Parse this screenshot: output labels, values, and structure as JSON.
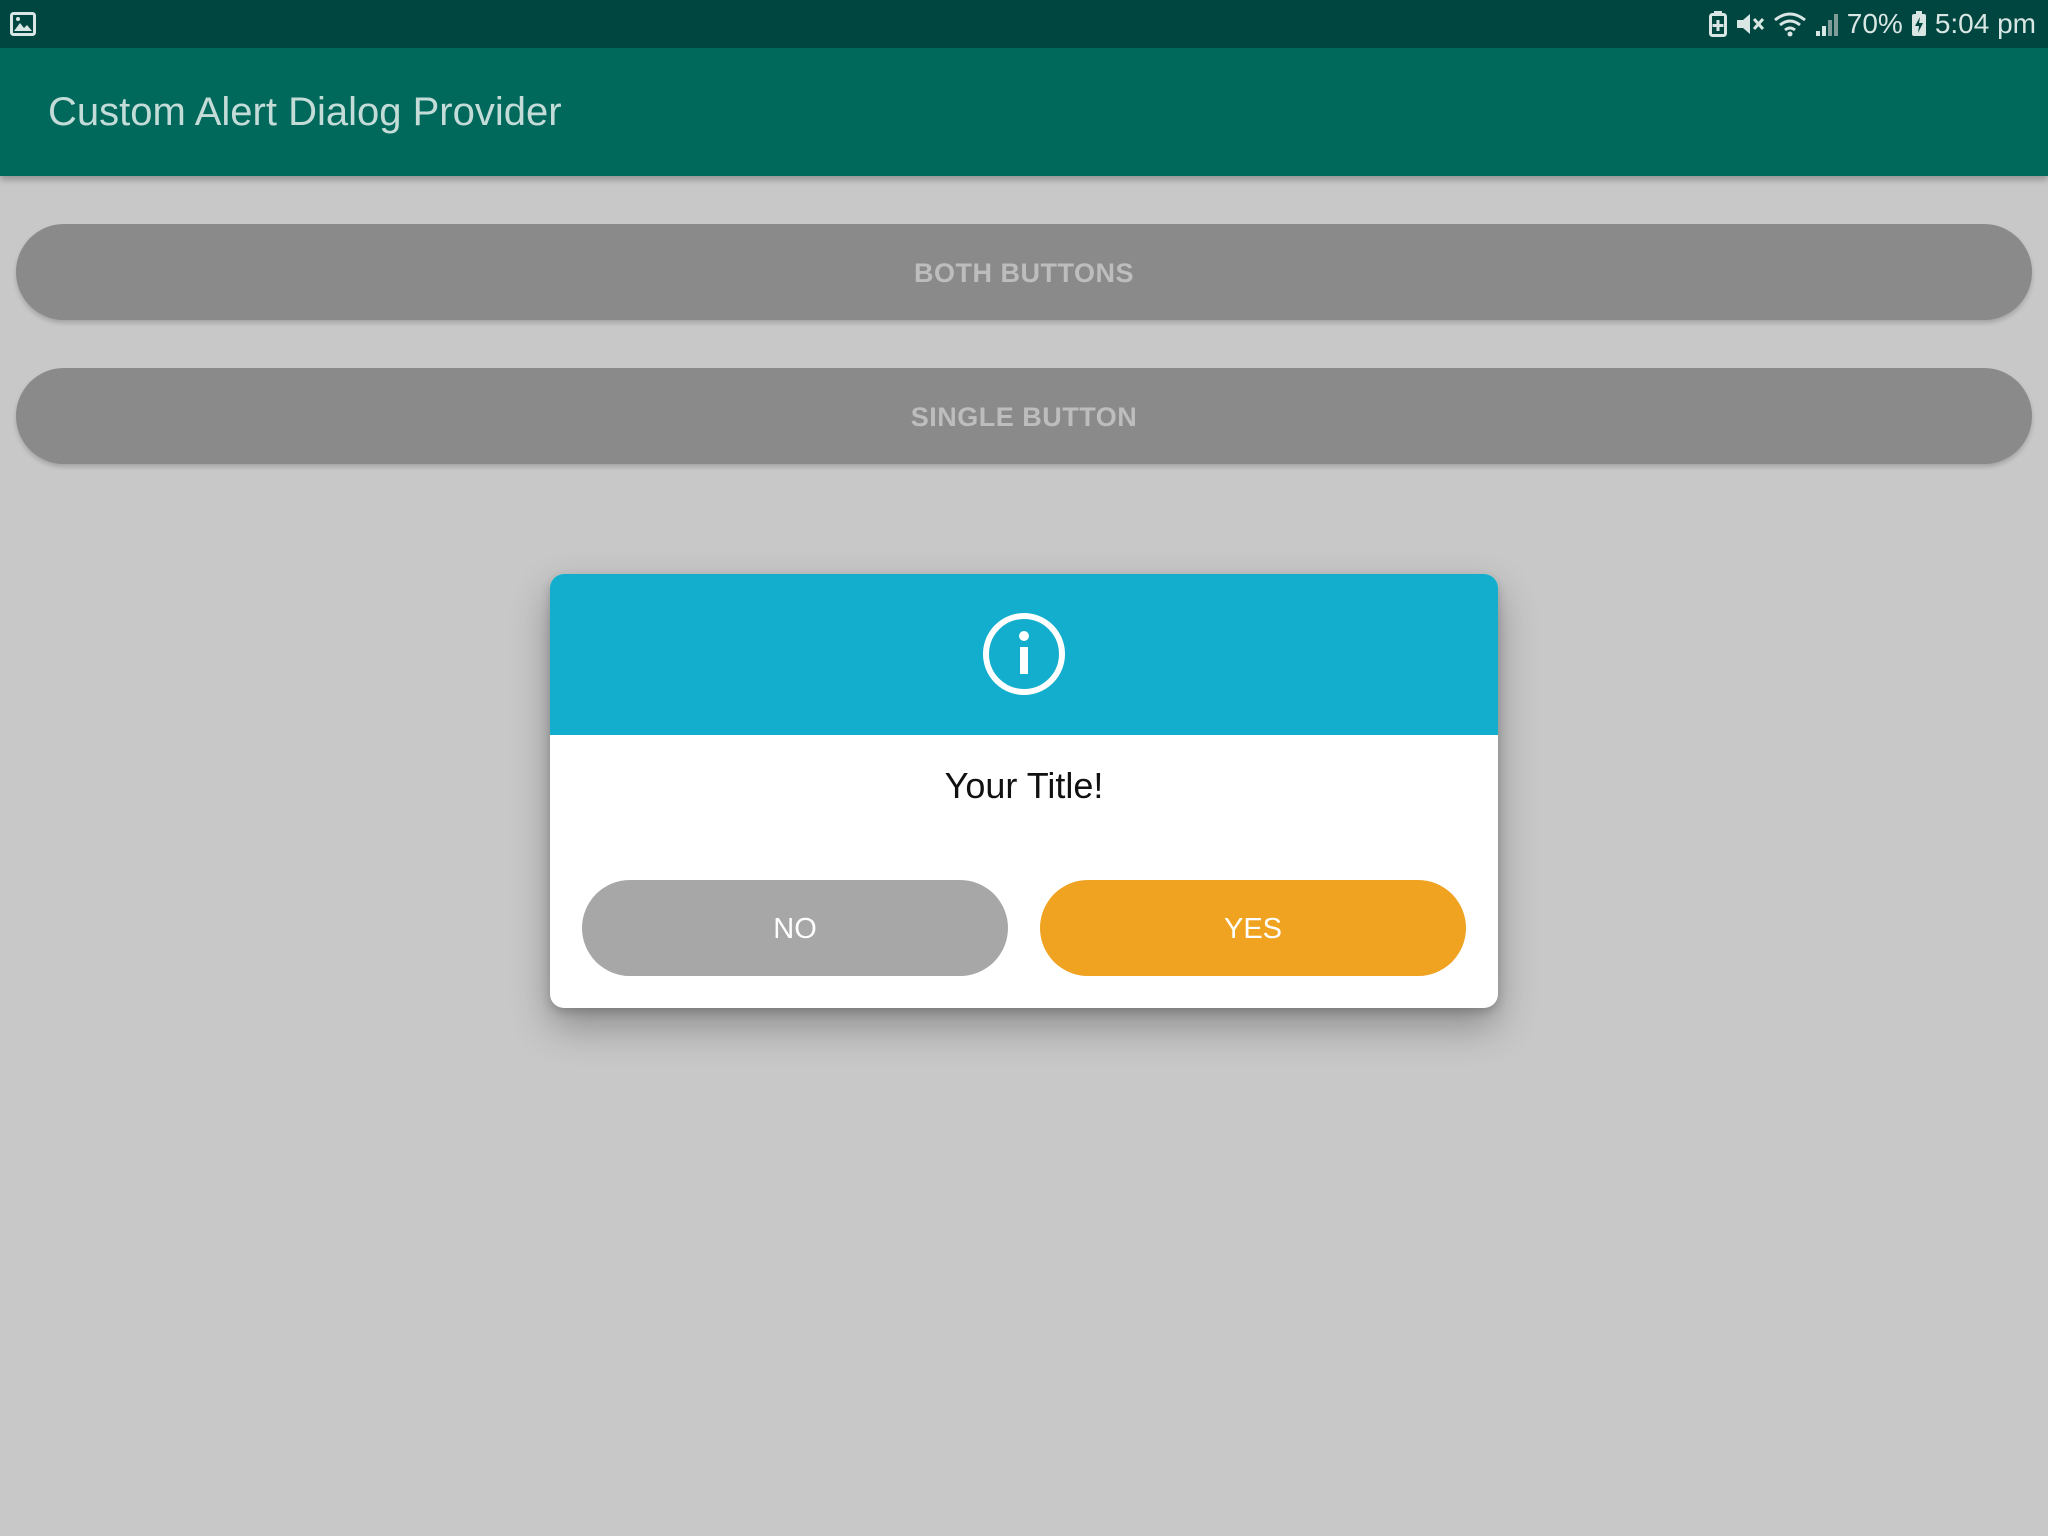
{
  "status_bar": {
    "battery_percent": "70%",
    "time": "5:04 pm",
    "icons": [
      "gallery-icon",
      "battery-saver-icon",
      "mute-icon",
      "wifi-icon",
      "signal-icon",
      "battery-icon"
    ]
  },
  "app_bar": {
    "title": "Custom Alert Dialog Provider"
  },
  "main": {
    "both_buttons_label": "BOTH BUTTONS",
    "single_button_label": "SINGLE BUTTON"
  },
  "dialog": {
    "icon": "info-icon",
    "title": "Your Title!",
    "no_label": "NO",
    "yes_label": "YES"
  },
  "colors": {
    "status_bar": "#004640",
    "app_bar": "#00695c",
    "background": "#c8c8c8",
    "dialog_header": "#13aecd",
    "no_button": "#a8a7a8",
    "yes_button": "#f0a320"
  }
}
